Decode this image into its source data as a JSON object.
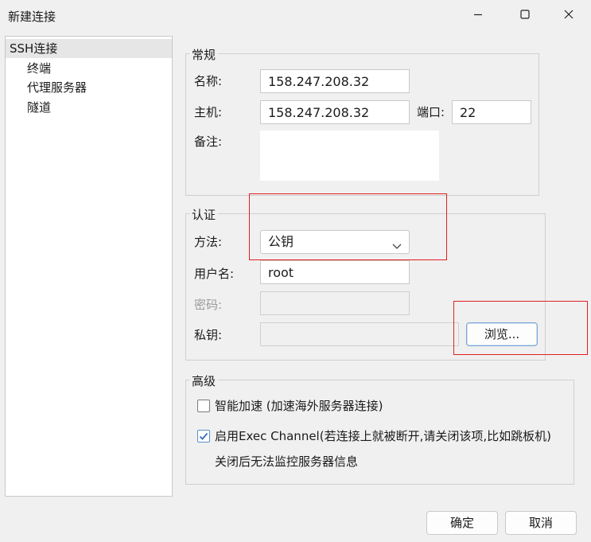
{
  "window": {
    "title": "新建连接",
    "icons": {
      "minimize": "minimize-icon",
      "maximize": "maximize-icon",
      "close": "close-icon"
    }
  },
  "nav": {
    "items": [
      {
        "label": "SSH连接",
        "selected": true
      },
      {
        "label": "终端"
      },
      {
        "label": "代理服务器"
      },
      {
        "label": "隧道"
      }
    ]
  },
  "general": {
    "title": "常规",
    "name_label": "名称:",
    "name_value": "158.247.208.32",
    "host_label": "主机:",
    "host_value": "158.247.208.32",
    "port_label": "端口:",
    "port_value": "22",
    "note_label": "备注:",
    "note_value": ""
  },
  "auth": {
    "title": "认证",
    "method_label": "方法:",
    "method_value": "公钥",
    "user_label": "用户名:",
    "user_value": "root",
    "password_label": "密码:",
    "password_value": "",
    "key_label": "私钥:",
    "key_value": "",
    "browse_label": "浏览..."
  },
  "advanced": {
    "title": "高级",
    "smart_accel_label": "智能加速 (加速海外服务器连接)",
    "smart_accel_checked": false,
    "exec_channel_label": "启用Exec Channel(若连接上就被断开,请关闭该项,比如跳板机)",
    "exec_channel_checked": true,
    "exec_note": "关闭后无法监控服务器信息"
  },
  "footer": {
    "ok_label": "确定",
    "cancel_label": "取消"
  },
  "colors": {
    "highlight_box": "#e02020",
    "check_accent": "#2f6fb7"
  }
}
